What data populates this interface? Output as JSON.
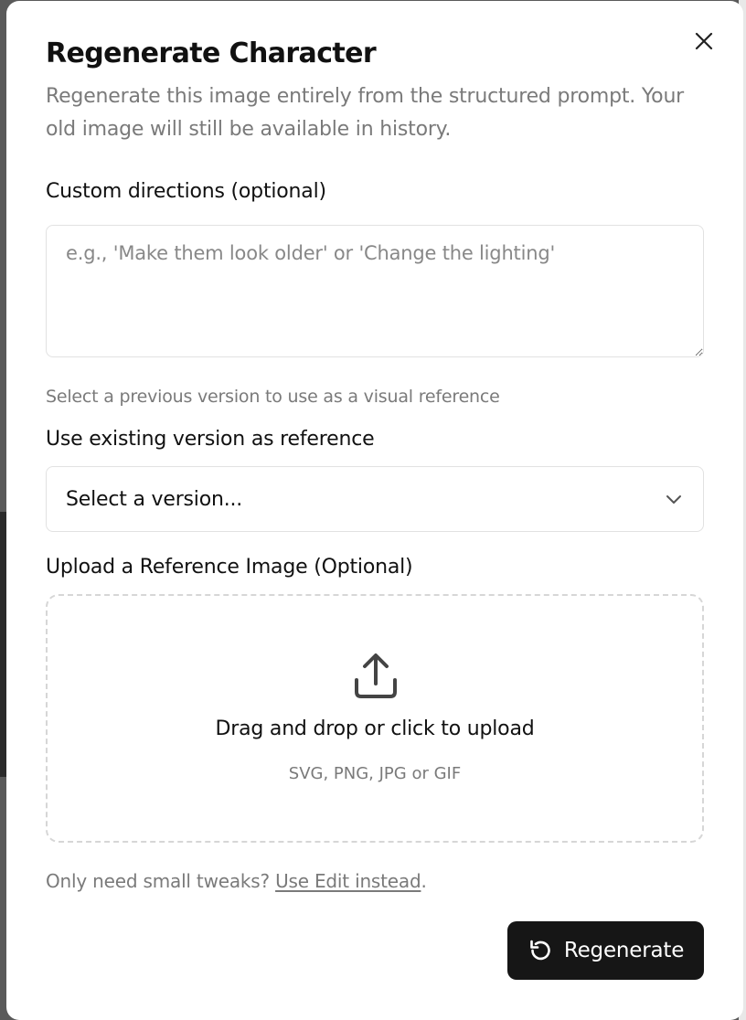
{
  "modal": {
    "title": "Regenerate Character",
    "description": "Regenerate this image entirely from the structured prompt. Your old image will still be available in history.",
    "close_icon": "close-icon"
  },
  "custom_directions": {
    "label": "Custom directions (optional)",
    "placeholder": "e.g., 'Make them look older' or 'Change the lighting'",
    "value": ""
  },
  "reference_version": {
    "helper": "Select a previous version to use as a visual reference",
    "label": "Use existing version as reference",
    "selected": "Select a version...",
    "icon": "chevron-down-icon"
  },
  "upload": {
    "label": "Upload a Reference Image (Optional)",
    "icon": "upload-icon",
    "title": "Drag and drop or click to upload",
    "formats": "SVG, PNG, JPG or GIF"
  },
  "footer": {
    "note": "Only need small tweaks? ",
    "link": "Use Edit instead",
    "suffix": "."
  },
  "regenerate_button": {
    "label": "Regenerate",
    "icon": "rotate-ccw-icon"
  },
  "colors": {
    "primary_button": "#161616",
    "muted_text": "#7a7a7a",
    "border": "#e2e2e2"
  }
}
